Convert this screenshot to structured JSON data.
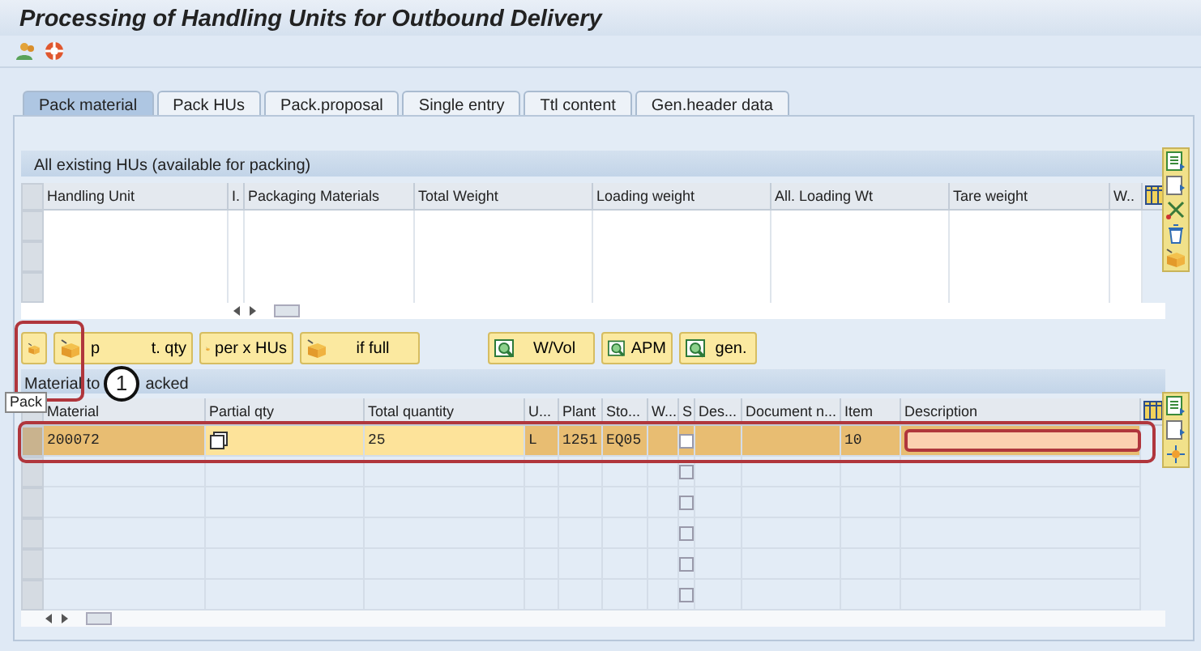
{
  "window": {
    "title": "Processing of Handling Units for Outbound Delivery"
  },
  "tabs": [
    {
      "label": "Pack material",
      "selected": true
    },
    {
      "label": "Pack HUs",
      "selected": false
    },
    {
      "label": "Pack.proposal",
      "selected": false
    },
    {
      "label": "Single entry",
      "selected": false
    },
    {
      "label": "Ttl content",
      "selected": false
    },
    {
      "label": "Gen.header data",
      "selected": false
    }
  ],
  "hu_section": {
    "title": "All existing HUs (available for packing)",
    "columns": [
      "Handling Unit",
      "I.",
      "Packaging Materials",
      "Total Weight",
      "Loading weight",
      "All. Loading Wt",
      "Tare weight",
      "W.."
    ]
  },
  "pack_buttons": [
    {
      "kind": "box"
    },
    {
      "kind": "box",
      "parts": [
        "p",
        "t. qty"
      ]
    },
    {
      "kind": "box",
      "parts": [
        "per x HUs"
      ]
    },
    {
      "kind": "box",
      "parts": [
        "if full"
      ]
    },
    {
      "kind": "find",
      "parts": [
        "W/Vol"
      ]
    },
    {
      "kind": "find",
      "parts": [
        "APM"
      ]
    },
    {
      "kind": "find",
      "parts": [
        "gen."
      ]
    }
  ],
  "tooltip": "Pack",
  "callout": "1",
  "material_section": {
    "title_parts": [
      "Material to",
      "acked"
    ],
    "columns": [
      "Material",
      "Partial qty",
      "Total quantity",
      "U...",
      "Plant",
      "Sto...",
      "W...",
      "S",
      "Des...",
      "Document n...",
      "Item",
      "Description"
    ],
    "rows": [
      {
        "selected": true,
        "material": "200072",
        "total_quantity": "25",
        "unit": "L",
        "plant": "1251",
        "storage": "EQ05",
        "checked": false,
        "item": "10"
      },
      {
        "selected": false,
        "checked": false
      },
      {
        "selected": false,
        "checked": false
      },
      {
        "selected": false,
        "checked": false
      },
      {
        "selected": false,
        "checked": false
      },
      {
        "selected": false,
        "checked": false
      }
    ]
  }
}
